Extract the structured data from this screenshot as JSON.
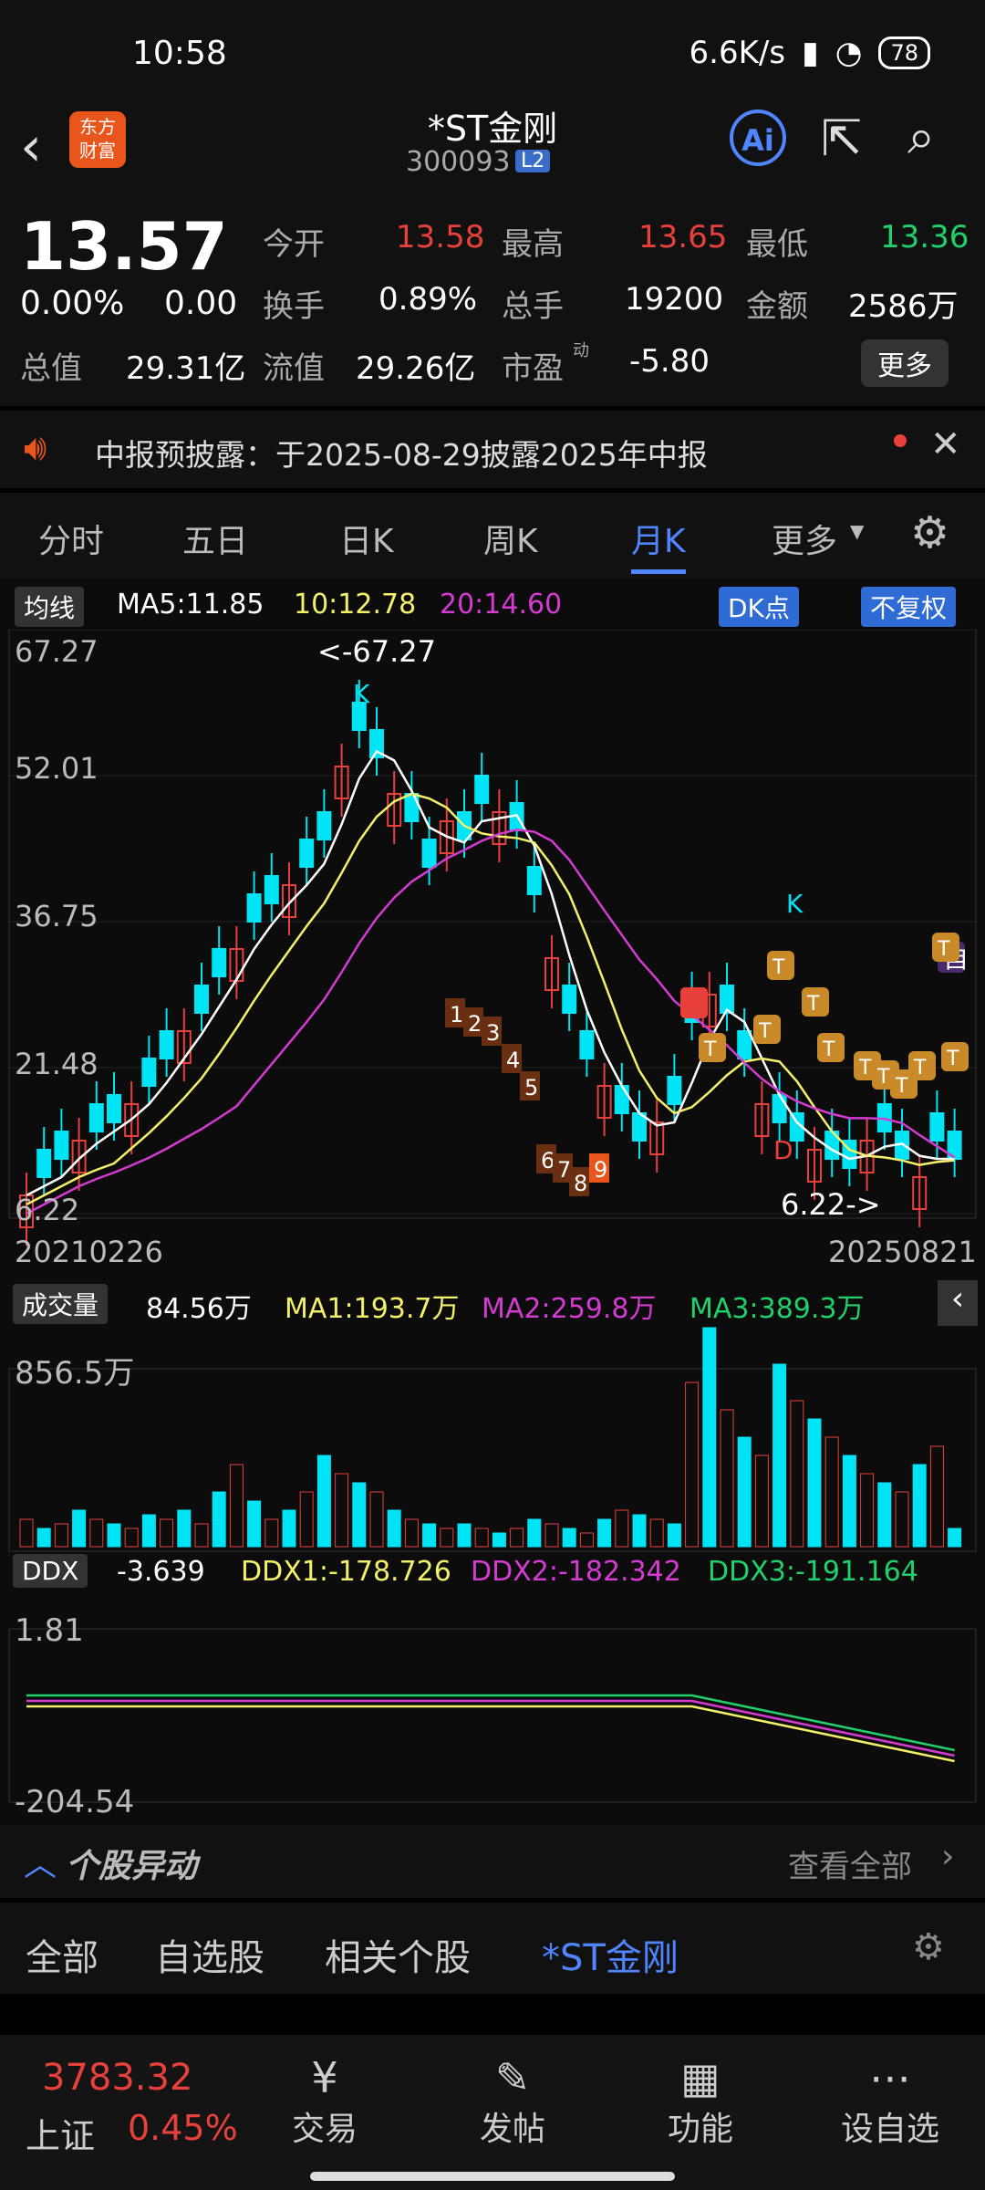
{
  "status_bar": {
    "time": "10:58",
    "speed": "6.6K/s",
    "battery": "78"
  },
  "header": {
    "title": "*ST金刚",
    "code": "300093",
    "level": "L2"
  },
  "quote": {
    "price": "13.57",
    "change_pct": "0.00%",
    "change": "0.00",
    "open_label": "今开",
    "open": "13.58",
    "high_label": "最高",
    "high": "13.65",
    "low_label": "最低",
    "low": "13.36",
    "turnover_label": "换手",
    "turnover": "0.89%",
    "volume_label": "总手",
    "volume": "19200",
    "amount_label": "金额",
    "amount": "2586万",
    "mcap_label": "总值",
    "mcap": "29.31亿",
    "float_label": "流值",
    "float_cap": "29.26亿",
    "pe_label": "市盈",
    "pe_sup": "动",
    "pe": "-5.80",
    "more": "更多"
  },
  "notice": {
    "text": "中报预披露：于2025-08-29披露2025年中报"
  },
  "tabs": [
    "分时",
    "五日",
    "日K",
    "周K",
    "月K",
    "更多"
  ],
  "active_tab": "月K",
  "ma_legend": {
    "type": "均线",
    "ma5": "MA5:11.85",
    "ma10": "10:12.78",
    "ma20": "20:14.60",
    "dk": "DK点",
    "fq": "不复权"
  },
  "colors": {
    "up": "#e8403b",
    "down": "#00e5f5",
    "ma5": "#ffffff",
    "ma10": "#f5f06a",
    "ma20": "#d43bd0",
    "accent": "#4f86ff"
  },
  "chart_data": {
    "type": "candlestick",
    "price_axis": [
      "67.27",
      "52.01",
      "36.75",
      "21.48",
      "6.22"
    ],
    "start_date": "20210226",
    "end_date": "20250821",
    "max_label": "<-67.27",
    "min_label": "6.22->",
    "markers": [
      "K",
      "K",
      "B",
      "D",
      "自"
    ],
    "td_counts": [
      "1",
      "2",
      "3",
      "4",
      "5",
      "6",
      "7",
      "8",
      "9"
    ],
    "volume_legend": {
      "type": "成交量",
      "vol": "84.56万",
      "ma1": "MA1:193.7万",
      "ma2": "MA2:259.8万",
      "ma3": "MA3:389.3万",
      "axis_max": "856.5万"
    },
    "ddx_legend": {
      "type": "DDX",
      "ddx": "-3.639",
      "ddx1": "DDX1:-178.726",
      "ddx2": "DDX2:-182.342",
      "ddx3": "DDX3:-191.164",
      "axis_max": "1.81",
      "axis_min": "-204.54"
    }
  },
  "movement": {
    "title": "个股异动",
    "view_all": "查看全部"
  },
  "filters": [
    "全部",
    "自选股",
    "相关个股",
    "*ST金刚"
  ],
  "bottom_nav": {
    "index_value": "3783.32",
    "index_name": "上证",
    "index_pct": "0.45%",
    "items": [
      "交易",
      "发帖",
      "功能",
      "设自选"
    ]
  }
}
